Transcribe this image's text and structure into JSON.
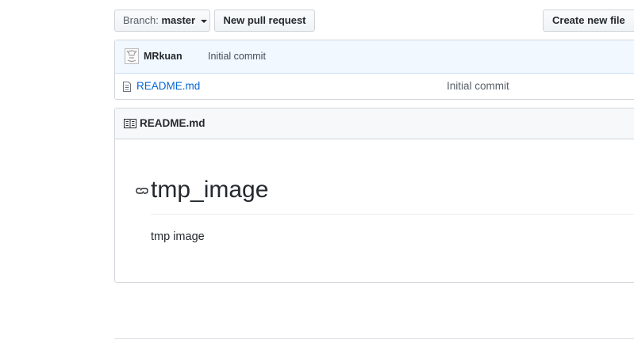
{
  "toolbar": {
    "branch_label": "Branch:",
    "branch_value": "master",
    "new_pull_request": "New pull request",
    "create_new_file": "Create new file"
  },
  "commit": {
    "author": "MRkuan",
    "message": "Initial commit"
  },
  "files": [
    {
      "name": "README.md",
      "commit_message": "Initial commit",
      "icon": "file-text-icon"
    }
  ],
  "readme": {
    "header_title": "README.md",
    "heading": "tmp_image",
    "paragraph": "tmp image"
  },
  "colors": {
    "link": "#0366d6",
    "commit_bar_bg": "#f1f8ff",
    "header_bg": "#f6f8fa",
    "border": "#d1d5da"
  }
}
